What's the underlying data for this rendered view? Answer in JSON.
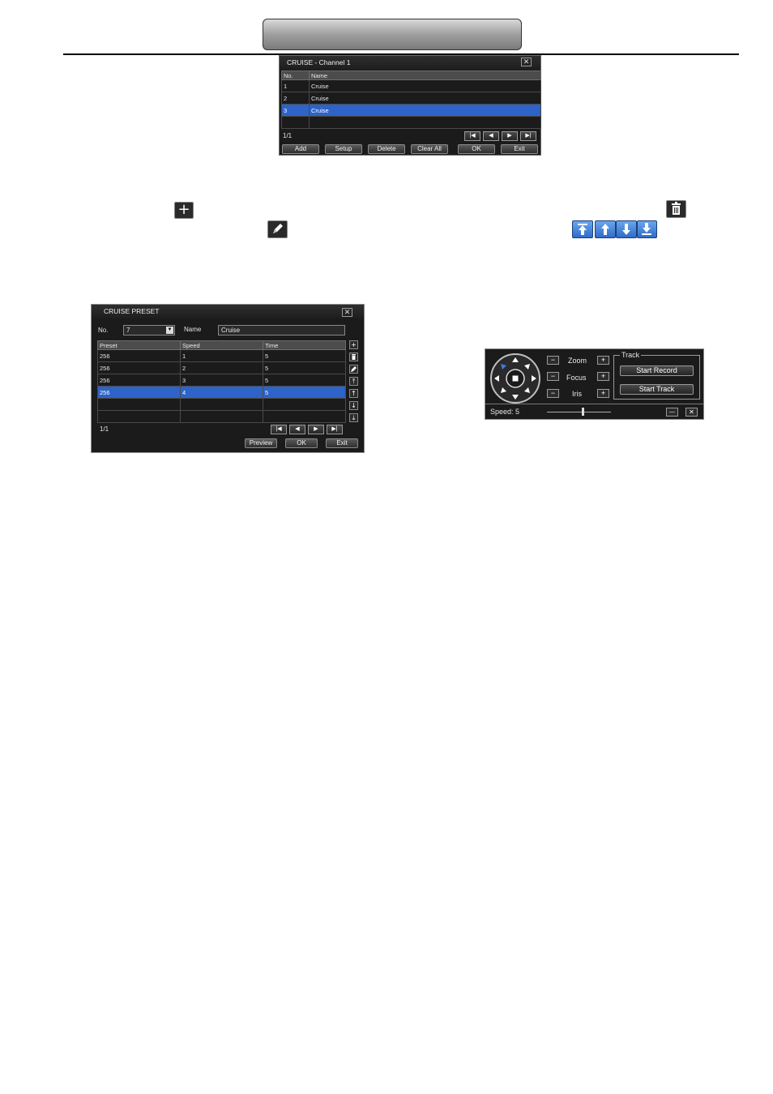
{
  "cruise_list_dialog": {
    "title": "CRUISE - Channel 1",
    "close_glyph": "✕",
    "columns": [
      "No.",
      "Name"
    ],
    "rows": [
      {
        "no": "1",
        "name": "Cruise"
      },
      {
        "no": "2",
        "name": "Cruise"
      },
      {
        "no": "3",
        "name": "Cruise"
      }
    ],
    "selected_row": 3,
    "page": "1/1",
    "buttons": {
      "add": "Add",
      "setup": "Setup",
      "delete": "Delete",
      "clear_all": "Clear All",
      "ok": "OK",
      "exit": "Exit"
    }
  },
  "icons": {
    "add": "+",
    "delete": "trash-icon",
    "modify": "pencil-icon",
    "move_arrows": [
      "move-top-icon",
      "move-up-icon",
      "move-down-icon",
      "move-bottom-icon"
    ]
  },
  "cruise_preset_dialog": {
    "title": "CRUISE PRESET",
    "no_label": "No.",
    "no_value": "7",
    "name_label": "Name",
    "name_value": "Cruise",
    "columns": [
      "Preset",
      "Speed",
      "Time"
    ],
    "rows": [
      {
        "preset": "256",
        "speed": "1",
        "time": "5"
      },
      {
        "preset": "256",
        "speed": "2",
        "time": "5"
      },
      {
        "preset": "256",
        "speed": "3",
        "time": "5"
      },
      {
        "preset": "256",
        "speed": "4",
        "time": "5"
      }
    ],
    "selected_row": 4,
    "page": "1/1",
    "buttons": {
      "preview": "Preview",
      "ok": "OK",
      "exit": "Exit"
    }
  },
  "ptz_panel": {
    "zoom_label": "Zoom",
    "focus_label": "Focus",
    "iris_label": "Iris",
    "minus": "−",
    "plus": "+",
    "track_group": "Track",
    "start_record": "Start Record",
    "start_track": "Start Track",
    "speed_text": "Speed: 5",
    "speed_value": 5,
    "minimize_glyph": "—",
    "close_glyph": "✕"
  },
  "colors": {
    "dialog_bg": "#1b1b1b",
    "selection": "#2e63c7",
    "header_bar": "#9f9f9f"
  }
}
